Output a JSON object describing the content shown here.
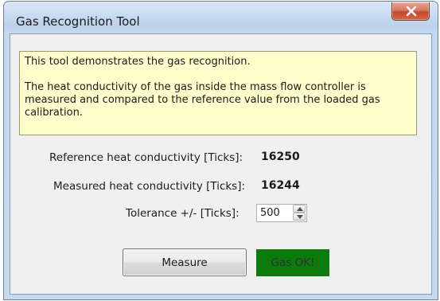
{
  "window": {
    "title": "Gas Recognition Tool",
    "close_label": "X"
  },
  "info": {
    "line1": "This tool demonstrates the gas recognition.",
    "line2": "The heat conductivity of the gas inside the mass flow controller is measured and compared to the reference value from the loaded gas calibration."
  },
  "reference": {
    "label": "Reference heat conductivity [Ticks]:",
    "value": "16250"
  },
  "measured": {
    "label": "Measured heat conductivity [Ticks]:",
    "value": "16244"
  },
  "tolerance": {
    "label": "Tolerance +/- [Ticks]:",
    "value": "500"
  },
  "actions": {
    "measure_label": "Measure",
    "status_text": "Gas OK!"
  },
  "colors": {
    "status_ok_bg": "#0c7a0c",
    "info_bg": "#ffffcc",
    "close_button": "#c6482c"
  }
}
